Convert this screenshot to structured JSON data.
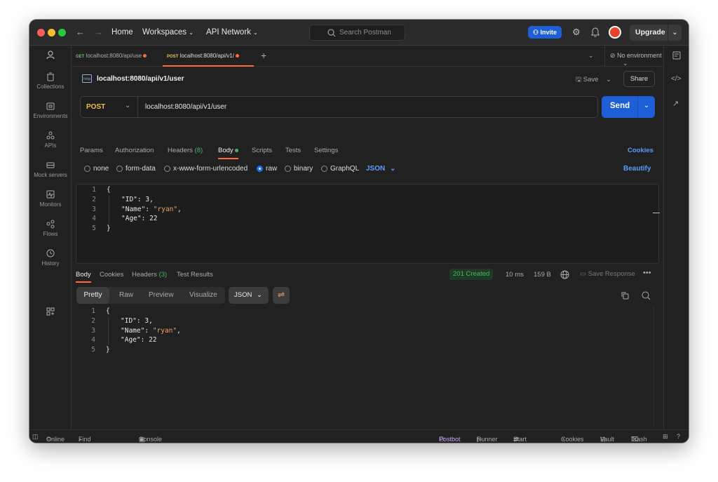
{
  "titlebar": {
    "home": "Home",
    "workspaces": "Workspaces",
    "api_network": "API Network",
    "search_placeholder": "Search Postman",
    "invite": "Invite",
    "upgrade": "Upgrade"
  },
  "sidebar": {
    "items": [
      {
        "label": "Collections",
        "icon": "trash-can-icon"
      },
      {
        "label": "Environments",
        "icon": "environment-icon"
      },
      {
        "label": "APIs",
        "icon": "apis-icon"
      },
      {
        "label": "Mock servers",
        "icon": "mock-server-icon"
      },
      {
        "label": "Monitors",
        "icon": "monitor-icon"
      },
      {
        "label": "Flows",
        "icon": "flows-icon"
      },
      {
        "label": "History",
        "icon": "history-icon"
      }
    ]
  },
  "tabs": [
    {
      "method": "GET",
      "title": "localhost:8080/api/use"
    },
    {
      "method": "POST",
      "title": "localhost:8080/api/v1/"
    }
  ],
  "environment": "No environment",
  "request": {
    "name": "localhost:8080/api/v1/user",
    "save": "Save",
    "share": "Share",
    "method": "POST",
    "url": "localhost:8080/api/v1/user",
    "send": "Send",
    "subtabs": [
      "Params",
      "Authorization",
      "Headers",
      "Body",
      "Scripts",
      "Tests",
      "Settings"
    ],
    "headers_count": "(8)",
    "cookies": "Cookies",
    "body_types": [
      "none",
      "form-data",
      "x-www-form-urlencoded",
      "raw",
      "binary",
      "GraphQL"
    ],
    "format": "JSON",
    "beautify": "Beautify",
    "body_lines": [
      "1",
      "2",
      "3",
      "4",
      "5"
    ],
    "body_json": {
      "open": "{",
      "k1": "\"ID\"",
      "v1": "3",
      "k2": "\"Name\"",
      "v2": "\"ryan\"",
      "k3": "\"Age\"",
      "v3": "22",
      "close": "}"
    }
  },
  "response": {
    "tabs": [
      "Body",
      "Cookies",
      "Headers",
      "Test Results"
    ],
    "headers_count": "(3)",
    "status": "201 Created",
    "time": "10 ms",
    "size": "159 B",
    "save_response": "Save Response",
    "views": [
      "Pretty",
      "Raw",
      "Preview",
      "Visualize"
    ],
    "format": "JSON",
    "body_lines": [
      "1",
      "2",
      "3",
      "4",
      "5"
    ],
    "body_json": {
      "open": "{",
      "k1": "\"ID\"",
      "v1": "3",
      "k2": "\"Name\"",
      "v2": "\"ryan\"",
      "k3": "\"Age\"",
      "v3": "22",
      "close": "}"
    }
  },
  "statusbar": {
    "online": "Online",
    "find_replace": "Find and replace",
    "console": "Console",
    "postbot": "Postbot",
    "runner": "Runner",
    "start_proxy": "Start Proxy",
    "cookies": "Cookies",
    "vault": "Vault",
    "trash": "Trash"
  },
  "colors": {
    "accent": "#1e5fd8",
    "post": "#f0c04a",
    "created": "#4bb46b",
    "tab_dot": "#ff6c37"
  }
}
